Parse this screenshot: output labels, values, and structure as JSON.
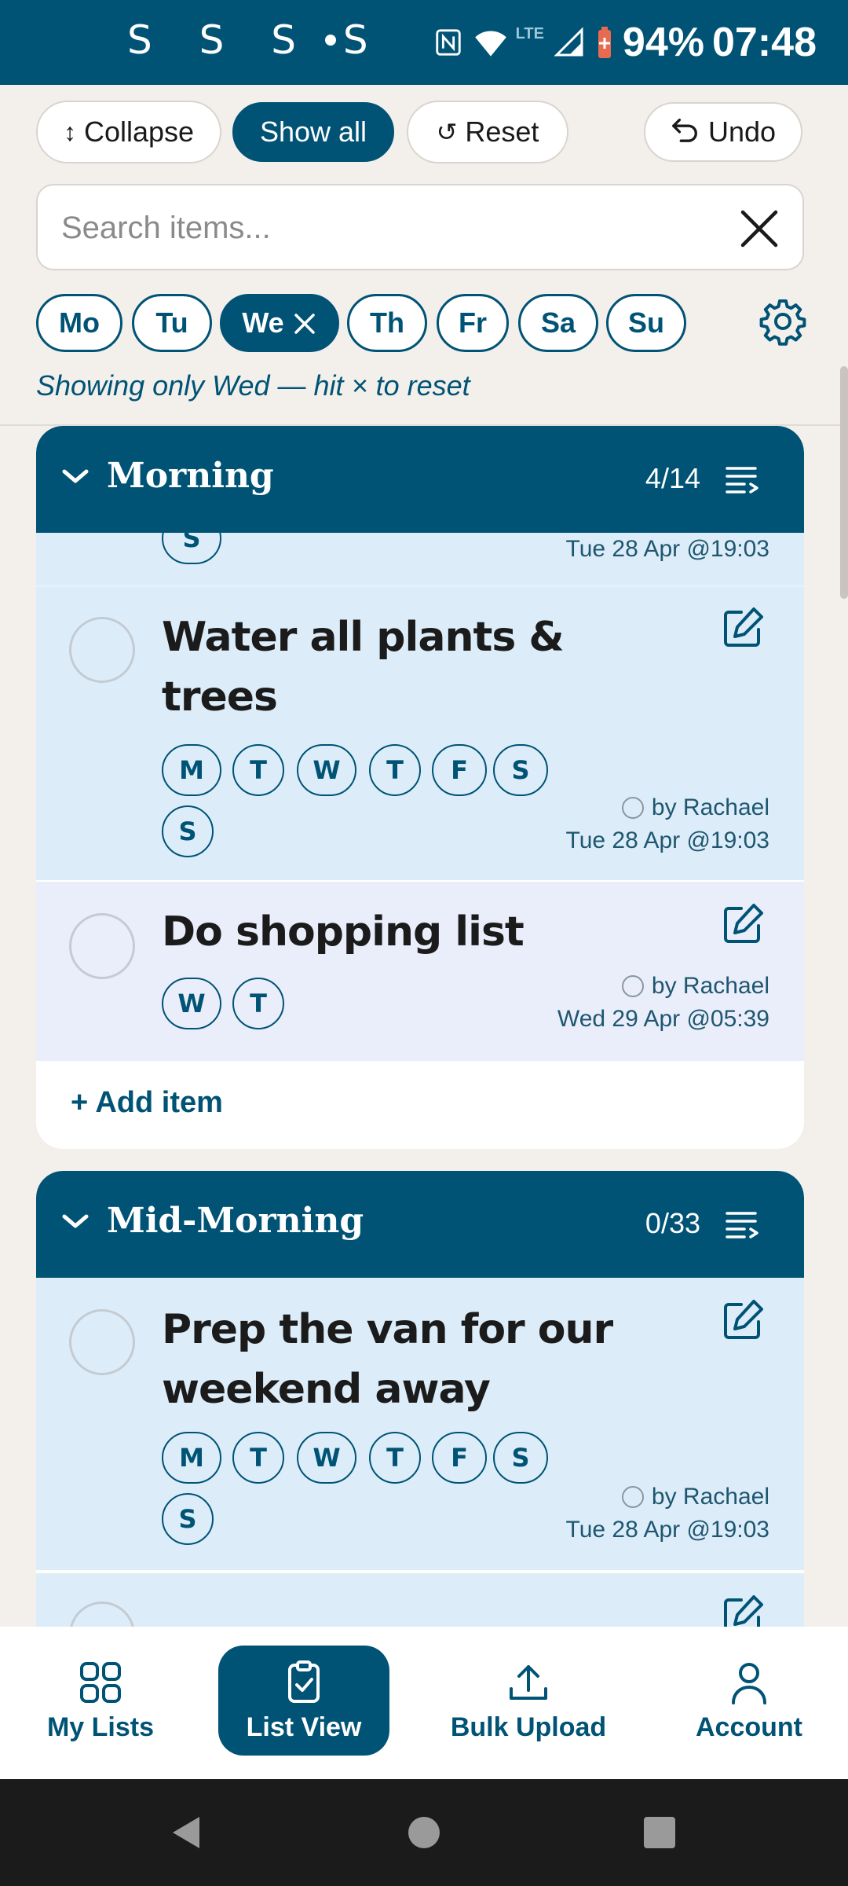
{
  "status_bar": {
    "left_icons": "S S S S",
    "battery": "94%",
    "time": "07:48",
    "network": "LTE"
  },
  "toolbar": {
    "collapse_label": "Collapse",
    "show_all_label": "Show all",
    "reset_label": "Reset",
    "undo_label": "Undo"
  },
  "search": {
    "placeholder": "Search items...",
    "value": ""
  },
  "days": [
    {
      "label": "Mo",
      "active": false
    },
    {
      "label": "Tu",
      "active": false
    },
    {
      "label": "We",
      "active": true
    },
    {
      "label": "Th",
      "active": false
    },
    {
      "label": "Fr",
      "active": false
    },
    {
      "label": "Sa",
      "active": false
    },
    {
      "label": "Su",
      "active": false
    }
  ],
  "filter_hint": "Showing only Wed — hit × to reset",
  "sections": [
    {
      "title": "Morning",
      "count": "4/14",
      "partial_item": {
        "chip": "S",
        "date": "Tue 28 Apr @19:03"
      },
      "items": [
        {
          "title_line1": "Water all plants &",
          "title_line2": "trees",
          "chips": [
            "M",
            "T",
            "W",
            "T",
            "F",
            "S",
            "S"
          ],
          "by": "by Rachael",
          "date": "Tue 28 Apr @19:03"
        },
        {
          "title_line1": "Do shopping list",
          "chips": [
            "W",
            "T"
          ],
          "by": "by Rachael",
          "date": "Wed 29 Apr @05:39"
        }
      ],
      "add_label": "+ Add item"
    },
    {
      "title": "Mid-Morning",
      "count": "0/33",
      "items": [
        {
          "title_line1": "Prep the van for our",
          "title_line2": "weekend away",
          "chips": [
            "M",
            "T",
            "W",
            "T",
            "F",
            "S",
            "S"
          ],
          "by": "by Rachael",
          "date": "Tue 28 Apr @19:03"
        }
      ]
    }
  ],
  "bottom_nav": [
    {
      "label": "My Lists",
      "icon": "grid-icon",
      "active": false
    },
    {
      "label": "List View",
      "icon": "clipboard-check-icon",
      "active": true
    },
    {
      "label": "Bulk Upload",
      "icon": "upload-icon",
      "active": false
    },
    {
      "label": "Account",
      "icon": "person-icon",
      "active": false
    }
  ],
  "colors": {
    "primary": "#005375",
    "item_blue": "#dcedf9",
    "item_lilac": "#e9eefa",
    "background": "#f3efeb"
  }
}
